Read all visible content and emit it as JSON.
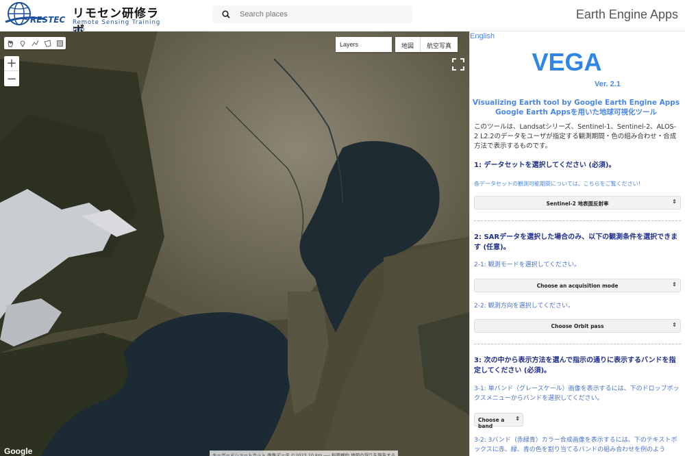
{
  "header": {
    "logo_jp": "リモセン研修ラボ",
    "logo_en": "Remote Sensing Training Lab",
    "logo_mark": "RESTEC",
    "search_placeholder": "Search places",
    "app_title": "Earth Engine Apps"
  },
  "map": {
    "layers_label": "Layers",
    "maptype_map": "地図",
    "maptype_satellite": "航空写真",
    "zoom_in": "+",
    "zoom_out": "−",
    "google_label": "Google",
    "attribution": "キーボードショートカット   画像データ ©2023   10 km ⎯⎯⎯   利用規約   地図の誤りを報告する"
  },
  "panel": {
    "lang_link": "English",
    "title": "VEGA",
    "version": "Ver. 2.1",
    "subtitle_en": "Visualizing Earth tool by Google Earth Engine Apps",
    "subtitle_jp": "Google Earth Appsを用いた地球可視化ツール",
    "description": "このツールは、Landsatシリーズ、Sentinel-1、Sentinel-2、ALOS-2 L2.2のデータをユーザが指定する観測期間・色の組み合わせ・合成方法で表示するものです。",
    "step1_heading": "1: データセットを選択してください (必須)。",
    "step1_link": "各データセットの観測可能期間については、こちらをご覧ください！",
    "dataset_select": "Sentinel-2 地表面反射率",
    "step2_heading": "2: SARデータを選択した場合のみ、以下の観測条件を選択できます (任意)。",
    "step2_1": "2-1: 観測モードを選択してください。",
    "acq_select": "Choose an acquisition mode",
    "step2_2": "2-2: 観測方向を選択してください。",
    "orbit_select": "Choose Orbit pass",
    "step3_heading": "3: 次の中から表示方法を選んで指示の通りに表示するバンドを指定してください (必須)。",
    "step3_1": "3-1: 単バンド（グレースケール）画像を表示するには、下のドロップボックスメニューからバンドを選択してください。",
    "band_select": "Choose a band",
    "step3_2": "3-2: 3バンド（赤緑青）カラー合成画像を表示するには、下のテキストボックスに赤、緑、青の色を割り当てるバンドの組み合わせを例のよう"
  }
}
